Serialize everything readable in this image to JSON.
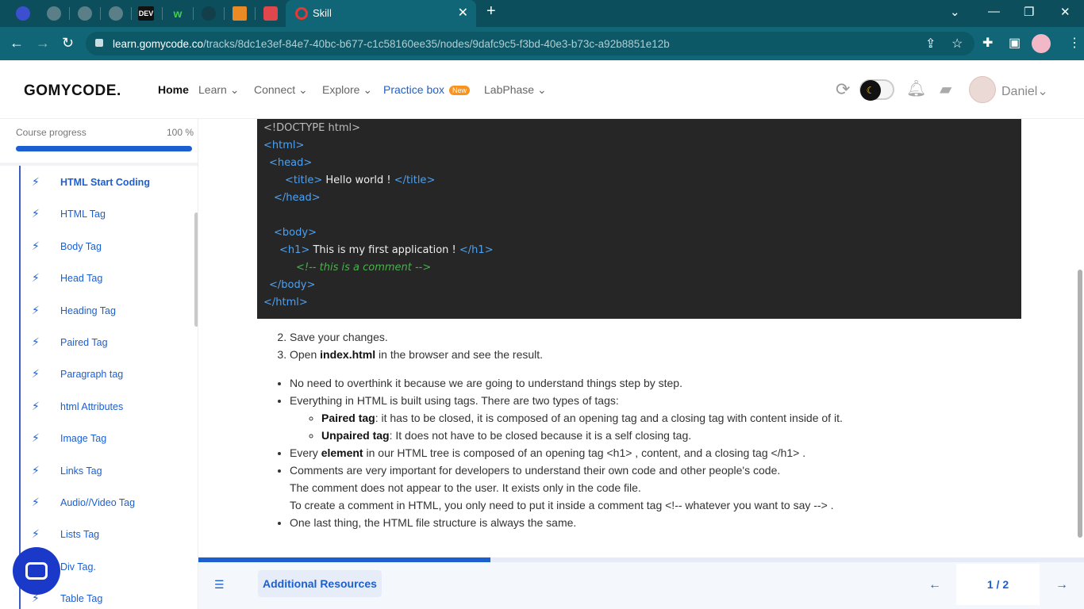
{
  "browser": {
    "pinned_tabs": [
      {
        "icon": "app-icon",
        "text": ""
      },
      {
        "icon": "globe-icon",
        "text": ""
      },
      {
        "icon": "globe-icon",
        "text": ""
      },
      {
        "icon": "globe-icon",
        "text": ""
      },
      {
        "icon": "dev-icon",
        "text": "DEV"
      },
      {
        "icon": "w-icon",
        "text": "w"
      },
      {
        "icon": "github-icon",
        "text": ""
      },
      {
        "icon": "stack-icon",
        "text": ""
      },
      {
        "icon": "sketch-icon",
        "text": ""
      }
    ],
    "active_tab": {
      "title": "Skill",
      "icon": "gomycode-icon"
    },
    "url_domain": "learn.gomycode.co",
    "url_path": "/tracks/8dc1e3ef-84e7-40bc-b677-c1c58160ee35/nodes/9dafc9c5-f3bd-40e3-b73c-a92b8851e12b"
  },
  "header": {
    "logo": "GOMYCODE.",
    "nav": {
      "home": "Home",
      "learn": "Learn",
      "connect": "Connect",
      "explore": "Explore",
      "practice": "Practice box",
      "new_badge": "New",
      "labphase": "LabPhase"
    },
    "user_name": "Daniel"
  },
  "sidebar": {
    "progress_label": "Course progress",
    "progress_value": "100 %",
    "progress_fraction": 1.0,
    "lessons": [
      {
        "label": "HTML Start Coding",
        "current": true
      },
      {
        "label": "HTML Tag"
      },
      {
        "label": "Body Tag"
      },
      {
        "label": "Head Tag"
      },
      {
        "label": "Heading Tag"
      },
      {
        "label": "Paired Tag"
      },
      {
        "label": "Paragraph tag"
      },
      {
        "label": "html Attributes"
      },
      {
        "label": "Image Tag"
      },
      {
        "label": "Links Tag"
      },
      {
        "label": "Audio//Video Tag"
      },
      {
        "label": "Lists Tag"
      },
      {
        "label": "Div Tag."
      },
      {
        "label": "Table Tag"
      }
    ]
  },
  "code": {
    "doctype": "<!DOCTYPE html>",
    "html_open": "html",
    "head_open": "head",
    "title_tag": "title",
    "title_text": " Hello world ! ",
    "head_close": "/head",
    "body_open": "body",
    "h1_tag": "h1",
    "h1_text": " This is my first application ! ",
    "comment": "<!-- this is a comment -->",
    "body_close": "/body",
    "html_close": "/html"
  },
  "content": {
    "step2": "Save your changes.",
    "step3_pre": "Open ",
    "step3_bold": "index.html",
    "step3_post": " in the browser and see the result.",
    "b1": "No need to overthink it because we are going to understand things step by step.",
    "b2": "Everything in HTML is built using tags. There are two types of tags:",
    "b2a_bold": "Paired tag",
    "b2a": ": it has to be closed, it is composed of an opening tag and a closing tag with content inside of it.",
    "b2b_bold": "Unpaired tag",
    "b2b": ": It does not have to be closed because it is a self closing tag.",
    "b3_pre": "Every ",
    "b3_bold": "element",
    "b3_post": " in our HTML tree is composed of an opening tag <h1> , content, and a closing tag </h1> .",
    "b4_l1": "Comments are very important for developers to understand their own code and other people's code.",
    "b4_l2": "The comment does not appear to the user. It exists only in the code file.",
    "b4_l3": "To create a comment in HTML, you only need to put it inside a comment tag <!-- whatever you want to say --> .",
    "b5": "One last thing, the HTML file structure is always the same."
  },
  "bottom": {
    "resources": "Additional Resources",
    "page": "1 / 2",
    "progress_fraction": 0.33
  }
}
